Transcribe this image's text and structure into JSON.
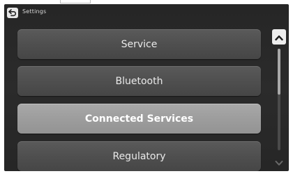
{
  "header": {
    "title": "Settings",
    "back_icon": "back-arrow-icon"
  },
  "menu": {
    "items": [
      {
        "label": "Service",
        "selected": false
      },
      {
        "label": "Bluetooth",
        "selected": false
      },
      {
        "label": "Connected Services",
        "selected": true
      },
      {
        "label": "Regulatory",
        "selected": false
      }
    ]
  },
  "scrollbar": {
    "up_icon": "chevron-up-icon",
    "down_icon": "chevron-down-icon",
    "thumb_start_fraction": 0.0,
    "thumb_end_fraction": 0.45
  },
  "colors": {
    "screen_background": "#262626",
    "item_background": "#4e4e4e",
    "selected_item_background": "#9c9c9c",
    "item_text": "#eaeaea"
  }
}
